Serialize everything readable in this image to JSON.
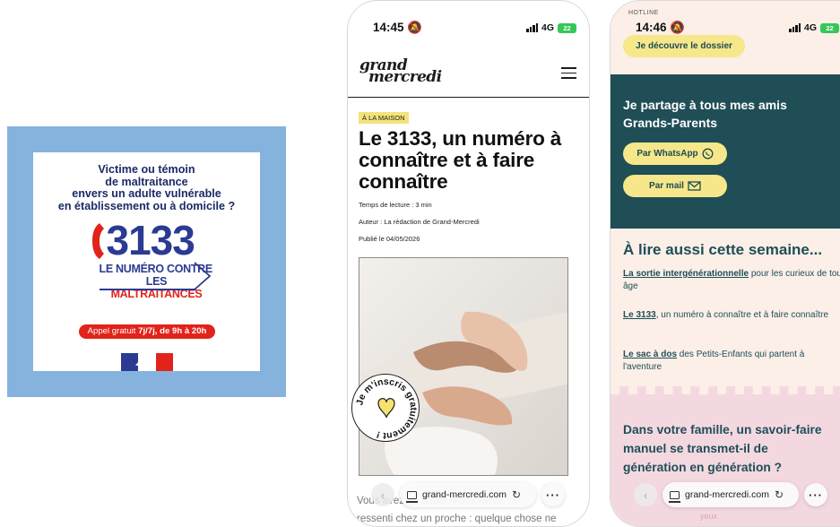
{
  "poster": {
    "question_lines": [
      "Victime ou témoin",
      "de maltraitance",
      "envers un adulte vulnérable",
      "en établissement ou à domicile ?"
    ],
    "hotline_number": "3133",
    "hotline_sub1": "LE NUMÉRO CONTRE",
    "hotline_sub2_prefix": "LES ",
    "hotline_sub2_red": "MALTRAITANCES",
    "call_prefix": "Appel gratuit ",
    "call_bold": "7j/7j, de 9h à 20h",
    "colors": {
      "frame": "#86b3de",
      "navy": "#2b3a93",
      "red": "#e2231a"
    }
  },
  "phone_a": {
    "status": {
      "time": "14:45",
      "network": "4G",
      "battery": "22"
    },
    "site_logo_line1": "grand",
    "site_logo_line2": "mercredi",
    "category": "À LA MAISON",
    "title": "Le 3133, un numéro à connaître et à faire connaître",
    "reading_time": "Temps de lecture : 3 min",
    "author": "Auteur : La rédaction de Grand-Mercredi",
    "published": "Publié le 04/05/2026",
    "badge_text": "Je m'inscris gratuitement !",
    "teaser_line1": "Vous avez un doute, vous l'avez",
    "teaser_line2": "ressenti chez un proche : quelque chose ne",
    "browser": {
      "url": "grand-mercredi.com"
    }
  },
  "phone_b": {
    "status": {
      "time": "14:46",
      "network": "4G",
      "battery": "22"
    },
    "hotline_tiny": "HOTLINE",
    "discover_btn": "Je découvre le dossier",
    "share_title_1": "Je partage à tous mes amis",
    "share_title_2": "Grands-Parents",
    "whatsapp_btn": "Par WhatsApp",
    "mail_btn": "Par mail",
    "read_title": "À lire aussi cette semaine...",
    "read_items": [
      {
        "link": "La sortie intergénérationnelle",
        "rest": " pour les curieux de tout âge"
      },
      {
        "link": "Le 3133",
        "rest": ", un numéro à connaître et à faire connaître"
      },
      {
        "link": "Le sac à dos",
        "rest": " des Petits-Enfants qui partent à l'aventure"
      }
    ],
    "pink_title_1": "Dans votre famille, un savoir-faire",
    "pink_title_2": "manuel se transmet-il de",
    "pink_title_3": "génération en génération ?",
    "pink_faded": "yeux",
    "browser": {
      "url": "grand-mercredi.com"
    }
  }
}
